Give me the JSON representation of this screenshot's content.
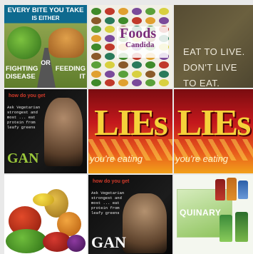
{
  "tiles": {
    "every_bite": {
      "header_line1": "EVERY BITE YOU TAKE",
      "header_line2": "IS EITHER",
      "or_text": "OR",
      "left_line1": "FIGHTING",
      "left_line2": "DISEASE",
      "right_line1": "FEEDING",
      "right_line2": "IT"
    },
    "candida": {
      "title_line1": "Foods",
      "title_line2": "Candida"
    },
    "eat_to_live": {
      "line1": "EAT TO LIVE.",
      "line2": "DON'T LIVE",
      "line3": "TO EAT."
    },
    "gan_one": {
      "question": "how do you get",
      "body": "Ask Vegetarian strongest and most ... eat protein from leafy greens",
      "brand": "GAN"
    },
    "eating_one": {
      "headline": "LIEs",
      "tagline": "you're eating"
    },
    "eating_two": {
      "headline": "LIEs",
      "tagline": "you're eating"
    },
    "gan_two": {
      "question": "how do you get",
      "body": "Ask Vegetarian strongest and most ... eat protein from leafy greens",
      "brand": "GAN"
    },
    "quinary": {
      "brand": "QUINARY"
    }
  },
  "colors": {
    "eat_bg": "#5c5238",
    "gan_green": "#9bc83b",
    "eating_red": "#c4181c",
    "candida_purple": "#7a2c7a"
  }
}
